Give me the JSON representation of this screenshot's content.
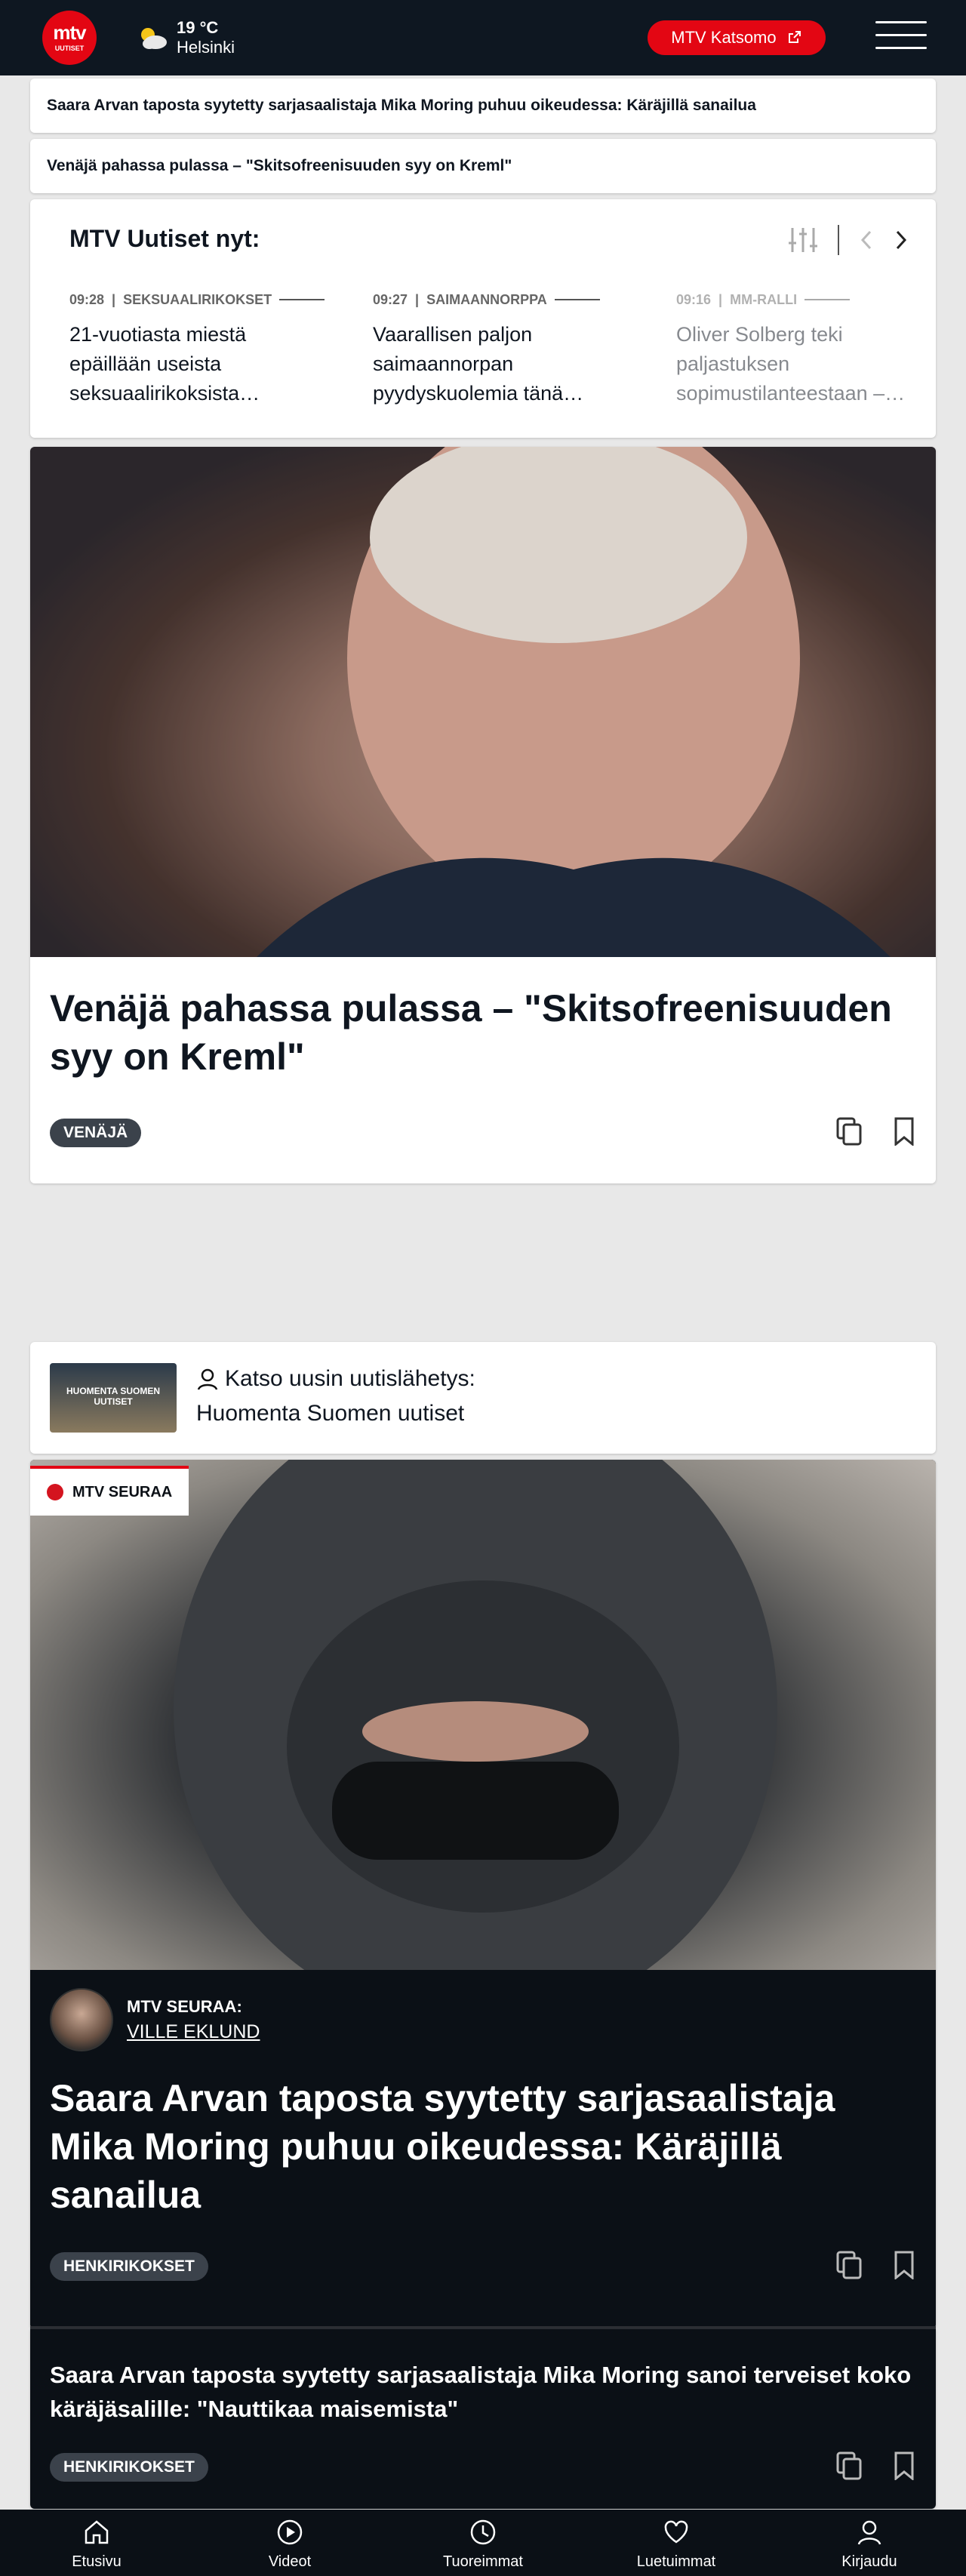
{
  "header": {
    "logo_top": "mtv",
    "logo_bottom": "UUTISET",
    "weather_temp": "19 °C",
    "weather_city": "Helsinki",
    "katsomo_label": "MTV Katsomo"
  },
  "ticker": [
    "Saara Arvan taposta syytetty sarjasaalistaja Mika Moring puhuu oikeudessa: Käräjillä sanailua",
    "Venäjä pahassa pulassa – \"Skitsofreenisuuden syy on Kreml\""
  ],
  "nyt": {
    "title": "MTV Uutiset nyt:",
    "items": [
      {
        "time": "09:28",
        "category": "SEKSUAALIRIKOKSET",
        "text": "21-vuotiasta miestä epäillään useista seksuaalirikoksista…"
      },
      {
        "time": "09:27",
        "category": "SAIMAANNORPPA",
        "text": "Vaarallisen paljon saimaannorpan pyydyskuolemia tänä…"
      },
      {
        "time": "09:16",
        "category": "MM-RALLI",
        "text": "Oliver Solberg teki paljastuksen sopimustilanteestaan –…"
      }
    ]
  },
  "hero": {
    "title": "Venäjä pahassa pulassa – \"Skitsofreenisuuden syy on Kreml\"",
    "tag": "VENÄJÄ"
  },
  "uutislahetys": {
    "thumb_text": "HUOMENTA SUOMEN UUTISET",
    "label": "Katso uusin uutislähetys:",
    "title": "Huomenta Suomen uutiset"
  },
  "seuraa": {
    "badge": "MTV SEURAA",
    "author_label": "MTV SEURAA:",
    "author_name": "VILLE EKLUND",
    "title": "Saara Arvan taposta syytetty sarjasaalistaja Mika Moring puhuu oikeudessa: Käräjillä sanailua",
    "tag": "HENKIRIKOKSET"
  },
  "subarticle": {
    "title": "Saara Arvan taposta syytetty sarjasaalistaja Mika Moring sanoi terveiset koko käräjäsalille: \"Nauttikaa maisemista\"",
    "tag": "HENKIRIKOKSET"
  },
  "tabs": [
    {
      "label": "Etusivu",
      "icon": "home-icon"
    },
    {
      "label": "Videot",
      "icon": "play-icon"
    },
    {
      "label": "Tuoreimmat",
      "icon": "clock-icon"
    },
    {
      "label": "Luetuimmat",
      "icon": "heart-icon"
    },
    {
      "label": "Kirjaudu",
      "icon": "user-icon"
    }
  ],
  "colors": {
    "brand": "#e30613",
    "dark": "#0b1016",
    "tag": "#3b424b"
  }
}
